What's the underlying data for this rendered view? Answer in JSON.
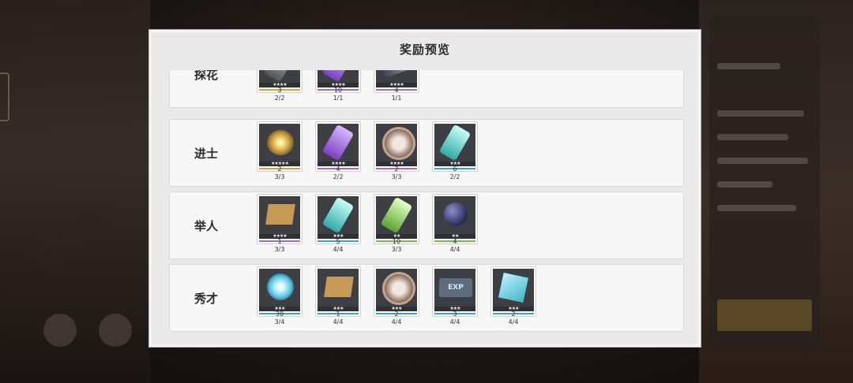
{
  "dialog": {
    "title": "奖励预览"
  },
  "rows": [
    {
      "label": "探花",
      "items": [
        {
          "icon": "gem-pile-icon",
          "rarity": "#d9a13a",
          "stars": "★★★★",
          "qty": "3",
          "count": "2/2"
        },
        {
          "icon": "purple-crystal-icon",
          "rarity": "#a06bd9",
          "stars": "★★★★",
          "qty": "10",
          "count": "1/1"
        },
        {
          "icon": "weapon-icon",
          "rarity": "#a06bd9",
          "stars": "★★★★",
          "qty": "4",
          "count": "1/1"
        }
      ]
    },
    {
      "label": "进士",
      "items": [
        {
          "icon": "gold-ore-icon",
          "rarity": "#d9a13a",
          "stars": "★★★★★",
          "qty": "2",
          "count": "3/3"
        },
        {
          "icon": "purple-crystal-icon",
          "rarity": "#a06bd9",
          "stars": "★★★★",
          "qty": "4",
          "count": "2/2"
        },
        {
          "icon": "emblem-coin-icon",
          "rarity": "#a06bd9",
          "stars": "★★★★",
          "qty": "2",
          "count": "3/3"
        },
        {
          "icon": "teal-crystal-icon",
          "rarity": "#3f9fd9",
          "stars": "★★★",
          "qty": "6",
          "count": "2/2"
        }
      ]
    },
    {
      "label": "举人",
      "items": [
        {
          "icon": "treasure-box-icon",
          "rarity": "#a06bd9",
          "stars": "★★★★",
          "qty": "1",
          "count": "3/3"
        },
        {
          "icon": "teal-crystal-icon",
          "rarity": "#3f9fd9",
          "stars": "★★★",
          "qty": "5",
          "count": "4/4"
        },
        {
          "icon": "green-crystal-icon",
          "rarity": "#6fbf4a",
          "stars": "★★",
          "qty": "10",
          "count": "3/3"
        },
        {
          "icon": "dark-orb-icon",
          "rarity": "#6fbf4a",
          "stars": "★★",
          "qty": "4",
          "count": "4/4"
        }
      ]
    },
    {
      "label": "秀才",
      "items": [
        {
          "icon": "blue-crystal-icon",
          "rarity": "#3f9fd9",
          "stars": "★★★",
          "qty": "30",
          "count": "3/4"
        },
        {
          "icon": "treasure-box-icon",
          "rarity": "#3f9fd9",
          "stars": "★★★",
          "qty": "1",
          "count": "4/4"
        },
        {
          "icon": "emblem-coin-icon",
          "rarity": "#3f9fd9",
          "stars": "★★★",
          "qty": "2",
          "count": "4/4"
        },
        {
          "icon": "exp-book-icon",
          "rarity": "#3f9fd9",
          "stars": "★★★",
          "qty": "3",
          "count": "4/4",
          "text": "EXP"
        },
        {
          "icon": "ice-cube-icon",
          "rarity": "#3f9fd9",
          "stars": "★★★",
          "qty": "2",
          "count": "4/4"
        }
      ]
    }
  ]
}
